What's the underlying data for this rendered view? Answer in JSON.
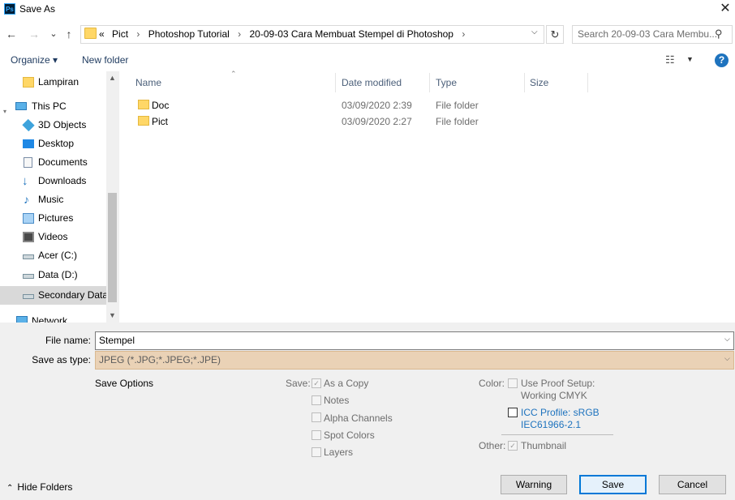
{
  "window": {
    "title": "Save As",
    "app_icon": "Ps",
    "close_glyph": "✕"
  },
  "nav": {
    "back_glyph": "←",
    "forward_glyph": "→",
    "recent_glyph": "⌄",
    "up_glyph": "↑",
    "overflow": "«",
    "breadcrumb": [
      "Pict",
      "Photoshop Tutorial",
      "20-09-03 Cara Membuat Stempel di Photoshop"
    ],
    "separator": "›",
    "search_placeholder": "Search 20-09-03 Cara Membu...",
    "refresh_glyph": "↻",
    "search_glyph": "⚲"
  },
  "toolbar": {
    "organize": "Organize ▾",
    "new_folder": "New folder",
    "help": "?"
  },
  "sidebar": {
    "items": [
      {
        "label": "Lampiran",
        "icon": "folder-icon"
      },
      {
        "label": "This PC",
        "icon": "pc-icon"
      },
      {
        "label": "3D Objects",
        "icon": "3d-objects-icon"
      },
      {
        "label": "Desktop",
        "icon": "desktop-icon"
      },
      {
        "label": "Documents",
        "icon": "documents-icon"
      },
      {
        "label": "Downloads",
        "icon": "downloads-icon"
      },
      {
        "label": "Music",
        "icon": "music-icon"
      },
      {
        "label": "Pictures",
        "icon": "pictures-icon"
      },
      {
        "label": "Videos",
        "icon": "videos-icon"
      },
      {
        "label": "Acer (C:)",
        "icon": "drive-icon"
      },
      {
        "label": "Data  (D:)",
        "icon": "drive-icon"
      },
      {
        "label": "Secondary Data",
        "icon": "drive-icon"
      },
      {
        "label": "Network",
        "icon": "network-icon"
      }
    ]
  },
  "files": {
    "columns": [
      "Name",
      "Date modified",
      "Type",
      "Size"
    ],
    "rows": [
      {
        "name": "Doc",
        "date": "03/09/2020 2:39",
        "type": "File folder"
      },
      {
        "name": "Pict",
        "date": "03/09/2020 2:27",
        "type": "File folder"
      }
    ]
  },
  "form": {
    "file_name_label": "File name:",
    "file_name_value": "Stempel",
    "save_type_label": "Save as type:",
    "save_type_value": "JPEG (*.JPG;*.JPEG;*.JPE)"
  },
  "options": {
    "title": "Save Options",
    "save_label": "Save:",
    "save_items": [
      {
        "label": "As a Copy",
        "checked": true
      },
      {
        "label": "Notes",
        "checked": false
      },
      {
        "label": "Alpha Channels",
        "checked": false
      },
      {
        "label": "Spot Colors",
        "checked": false
      },
      {
        "label": "Layers",
        "checked": false
      }
    ],
    "color_label": "Color:",
    "proof_line1": "Use Proof Setup:",
    "proof_line2": "Working CMYK",
    "icc_line1": "ICC Profile:  sRGB",
    "icc_line2": "IEC61966-2.1",
    "other_label": "Other:",
    "thumbnail": "Thumbnail"
  },
  "footer": {
    "hide_folders": "Hide Folders",
    "warning": "Warning",
    "save": "Save",
    "cancel": "Cancel"
  },
  "colors": {
    "accent": "#0078d7",
    "type_bg": "#ead2b6",
    "selected": "#d9d9d9"
  }
}
